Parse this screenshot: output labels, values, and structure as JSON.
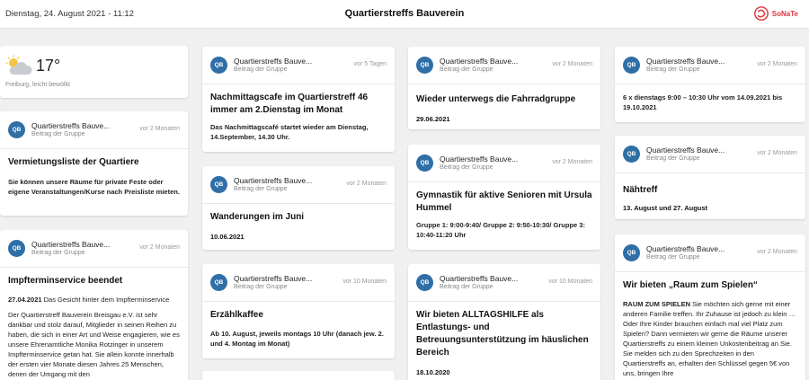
{
  "header": {
    "datetime": "Dienstag, 24. August 2021 - 11:12",
    "title": "Quartierstreffs Bauverein",
    "logo_text": "SoNaTe"
  },
  "weather": {
    "temperature": "17°",
    "description": "Freiburg, leicht bewölkt",
    "icon": "partly-cloudy-icon"
  },
  "colors": {
    "avatar": "#2f6fa6",
    "brand": "#d9353b"
  },
  "cards": [
    {
      "avatar": "QB",
      "author": "Quartierstreffs Bauve...",
      "subtitle": "Beitrag der Gruppe",
      "age": "vor 2 Monaten",
      "title": "Vermietungsliste der Quartiere",
      "text": "Sie können unsere Räume für private Feste oder eigene Veranstaltungen/Kurse nach Preisliste mieten."
    },
    {
      "avatar": "QB",
      "author": "Quartierstreffs Bauve...",
      "subtitle": "Beitrag der Gruppe",
      "age": "vor 2 Monaten",
      "title": "Impfterminservice beendet",
      "date_prefix": "27.04.2021",
      "date_rest": " Das Gesicht hinter dem Impfterminservice",
      "text": "Der Quartierstreff Bauverein Breisgau e.V. ist sehr dankbar und stolz darauf, Mitglieder in seinen Reihen zu haben, die sich in einer Art und Weise engagieren, wie es unsere Ehrenamtliche Monika Rotzinger in unserem Impfterminservice getan hat. Sie allein konnte innerhalb der ersten vier Monate diesen Jahres 25 Menschen, denen der Umgang mit den"
    },
    {
      "avatar": "QB",
      "author": "Quartierstreffs Bauve...",
      "subtitle": "Beitrag der Gruppe",
      "age": "vor 5 Tagen",
      "title": "Nachmittagscafe im Quartierstreff 46 immer am 2.Dienstag im Monat",
      "text": "Das Nachmittagscafé startet wieder am Dienstag, 14.September, 14.30 Uhr."
    },
    {
      "avatar": "QB",
      "author": "Quartierstreffs Bauve...",
      "subtitle": "Beitrag der Gruppe",
      "age": "vor 2 Monaten",
      "title": "Wanderungen im Juni",
      "date": "10.06.2021"
    },
    {
      "avatar": "QB",
      "author": "Quartierstreffs Bauve...",
      "subtitle": "Beitrag der Gruppe",
      "age": "vor 10 Monaten",
      "title": "Erzählkaffee",
      "text": "Ab 10. August, jeweils montags 10 Uhr (danach jew. 2. und 4. Montag im Monat)"
    },
    {
      "avatar": "QB",
      "author": "Quartierstreffs Bauve...",
      "subtitle": "Beitrag der Gruppe",
      "age": "vor 2 Monaten",
      "title": "Wieder unterwegs die Fahrradgruppe",
      "date": "29.06.2021"
    },
    {
      "avatar": "QB",
      "author": "Quartierstreffs Bauve...",
      "subtitle": "Beitrag der Gruppe",
      "age": "vor 2 Monaten",
      "title": "Gymnastik für aktive Senioren mit Ursula Hummel",
      "text": "Gruppe 1: 9:00-9:40/ Gruppe 2: 9:50-10:30/ Gruppe 3: 10:40-11:20 Uhr"
    },
    {
      "avatar": "QB",
      "author": "Quartierstreffs Bauve...",
      "subtitle": "Beitrag der Gruppe",
      "age": "vor 10 Monaten",
      "title": "Wir bieten ALLTAGSHILFE als Entlastungs- und Betreuungsunterstützung im häuslichen Bereich",
      "date": "18.10.2020"
    },
    {
      "avatar": "QB",
      "author": "Quartierstreffs Bauve...",
      "subtitle": "Beitrag der Gruppe",
      "age": "vor 2 Monaten",
      "title": "6 x dienstags 9:00 – 10:30 Uhr vom 14.09.2021 bis 19.10.2021"
    },
    {
      "avatar": "QB",
      "author": "Quartierstreffs Bauve...",
      "subtitle": "Beitrag der Gruppe",
      "age": "vor 2 Monaten",
      "title": "Nähtreff",
      "date": "13. August und 27. August"
    },
    {
      "avatar": "QB",
      "author": "Quartierstreffs Bauve...",
      "subtitle": "Beitrag der Gruppe",
      "age": "vor 2 Monaten",
      "title": "Wir bieten „Raum zum Spielen“",
      "bold_lead": "RAUM ZUM SPIELEN",
      "text": " Sie möchten sich gerne mit einer anderen Familie treffen. Ihr Zuhause ist jedoch zu klein … Oder Ihre Kinder brauchen einfach mal viel Platz zum Spielen? Dann vermieten wir gerne die Räume unserer Quartierstreffs zu einem kleinen Unkostenbeitrag an Sie. Sie melden sich zu den Sprechzeiten in den Quartierstreffs an, erhalten den Schlüssel gegen 5€ von uns, bringen Ihre"
    }
  ]
}
